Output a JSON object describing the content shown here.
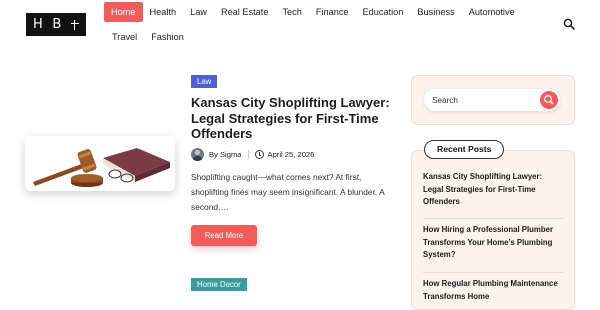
{
  "logo": {
    "letters": [
      "H",
      "B"
    ]
  },
  "nav": {
    "row1": [
      "Home",
      "Health",
      "Law",
      "Real Estate",
      "Tech",
      "Finance",
      "Education",
      "Business",
      "Automotive"
    ],
    "row2": [
      "Travel",
      "Fashion"
    ],
    "active": "Home"
  },
  "article": {
    "category": "Law",
    "title": "Kansas City Shoplifting Lawyer: Legal Strategies for First-Time Offenders",
    "author": "By Sigma",
    "date": "April 25, 2026",
    "excerpt": "Shoplifting caught—what comes next? At first, shoplifting fines may seem insignificant. A blunder. A second….",
    "read_more": "Read More"
  },
  "next_article": {
    "category": "Home Decor"
  },
  "sidebar": {
    "search_placeholder": "Search",
    "recent_title": "Recent Posts",
    "recent_posts": [
      "Kansas City Shoplifting Lawyer: Legal Strategies for First-Time Offenders",
      "How Hiring a Professional Plumber Transforms Your Home’s Plumbing System?",
      "How Regular Plumbing Maintenance Transforms Home"
    ]
  },
  "colors": {
    "accent": "#f25c5c",
    "law_badge": "#4f5fd6",
    "decor_badge": "#3a9d9d",
    "sidebar_bg": "#fdf3ee"
  },
  "icons": {
    "top_search": "search-icon",
    "sidebar_search": "search-icon",
    "meta_date": "clock-icon"
  }
}
